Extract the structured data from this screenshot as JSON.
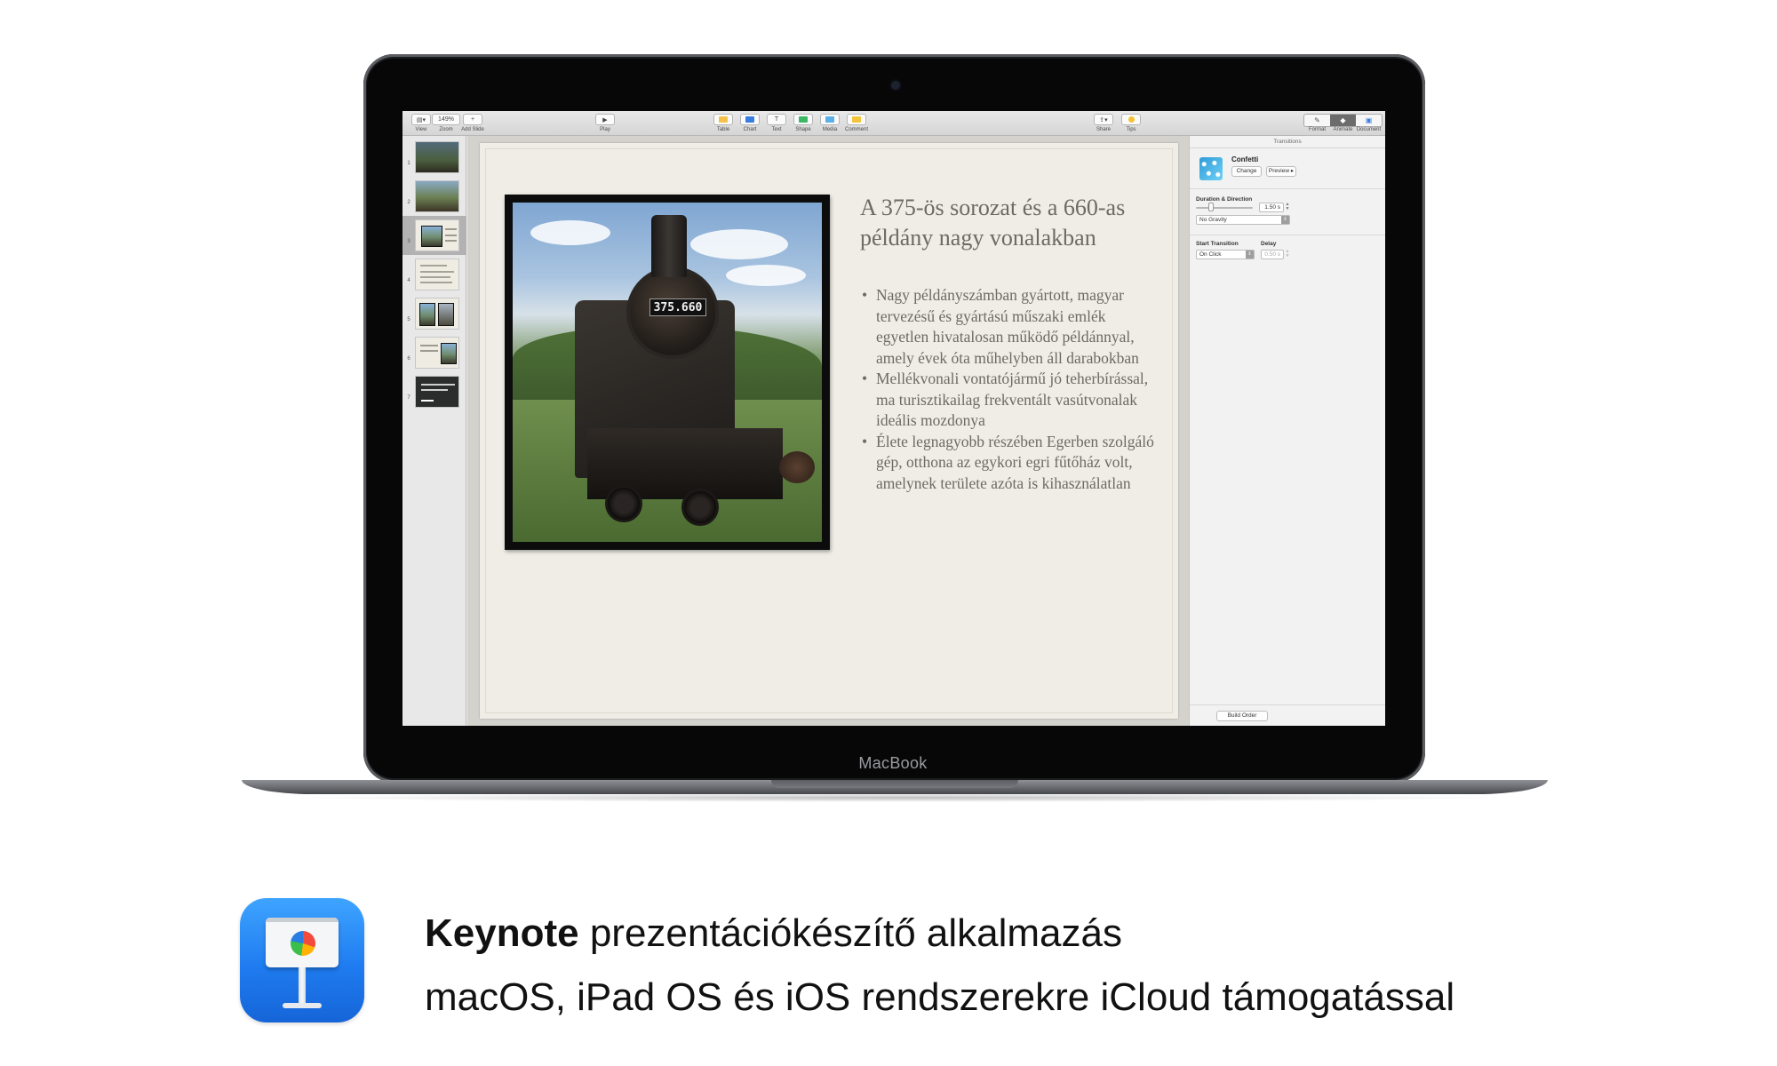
{
  "toolbar": {
    "view": "View",
    "zoom_value": "149%",
    "zoom": "Zoom",
    "add_slide": "Add Slide",
    "play": "Play",
    "table": "Table",
    "chart": "Chart",
    "text": "Text",
    "shape": "Shape",
    "media": "Media",
    "comment": "Comment",
    "share": "Share",
    "tips": "Tips",
    "format": "Format",
    "animate": "Animate",
    "document": "Document"
  },
  "navigator": {
    "selected_slide": 3,
    "slide_numbers": [
      "1",
      "2",
      "3",
      "4",
      "5",
      "6",
      "7"
    ]
  },
  "slide": {
    "title": "A 375-ös sorozat és a 660-as példány nagy vonalakban",
    "plate_text": "375.660",
    "bullets": [
      "Nagy példányszámban gyártott, magyar tervezésű és gyártású műszaki emlék egyetlen hivatalosan működő példánnyal, amely évek óta műhelyben áll darabokban",
      "Mellékvonali vontatójármű jó teherbírással, ma turisztikailag frekventált vasútvonalak ideális mozdonya",
      "Élete legnagyobb részében Egerben szolgáló gép, otthona az egykori egri fűtőház volt, amelynek területe azóta is kihasználatlan"
    ]
  },
  "inspector": {
    "header": "Transitions",
    "transition_name": "Confetti",
    "change_button": "Change",
    "preview_button": "Preview ▸",
    "duration_label": "Duration & Direction",
    "duration_value": "1.50 s",
    "direction_value": "No Gravity",
    "start_label": "Start Transition",
    "start_value": "On Click",
    "delay_label": "Delay",
    "delay_value": "0.50 s",
    "build_order_button": "Build Order"
  },
  "device": {
    "label": "MacBook"
  },
  "promo": {
    "app_name": "Keynote",
    "line1_rest": " prezentációkészítő alkalmazás",
    "line2": "macOS, iPad OS és iOS rendszerekre iCloud támogatással"
  },
  "colors": {
    "icon_blue": "#1f7cf0",
    "slide_text": "#6e6a62",
    "slide_background": "#efede6"
  }
}
